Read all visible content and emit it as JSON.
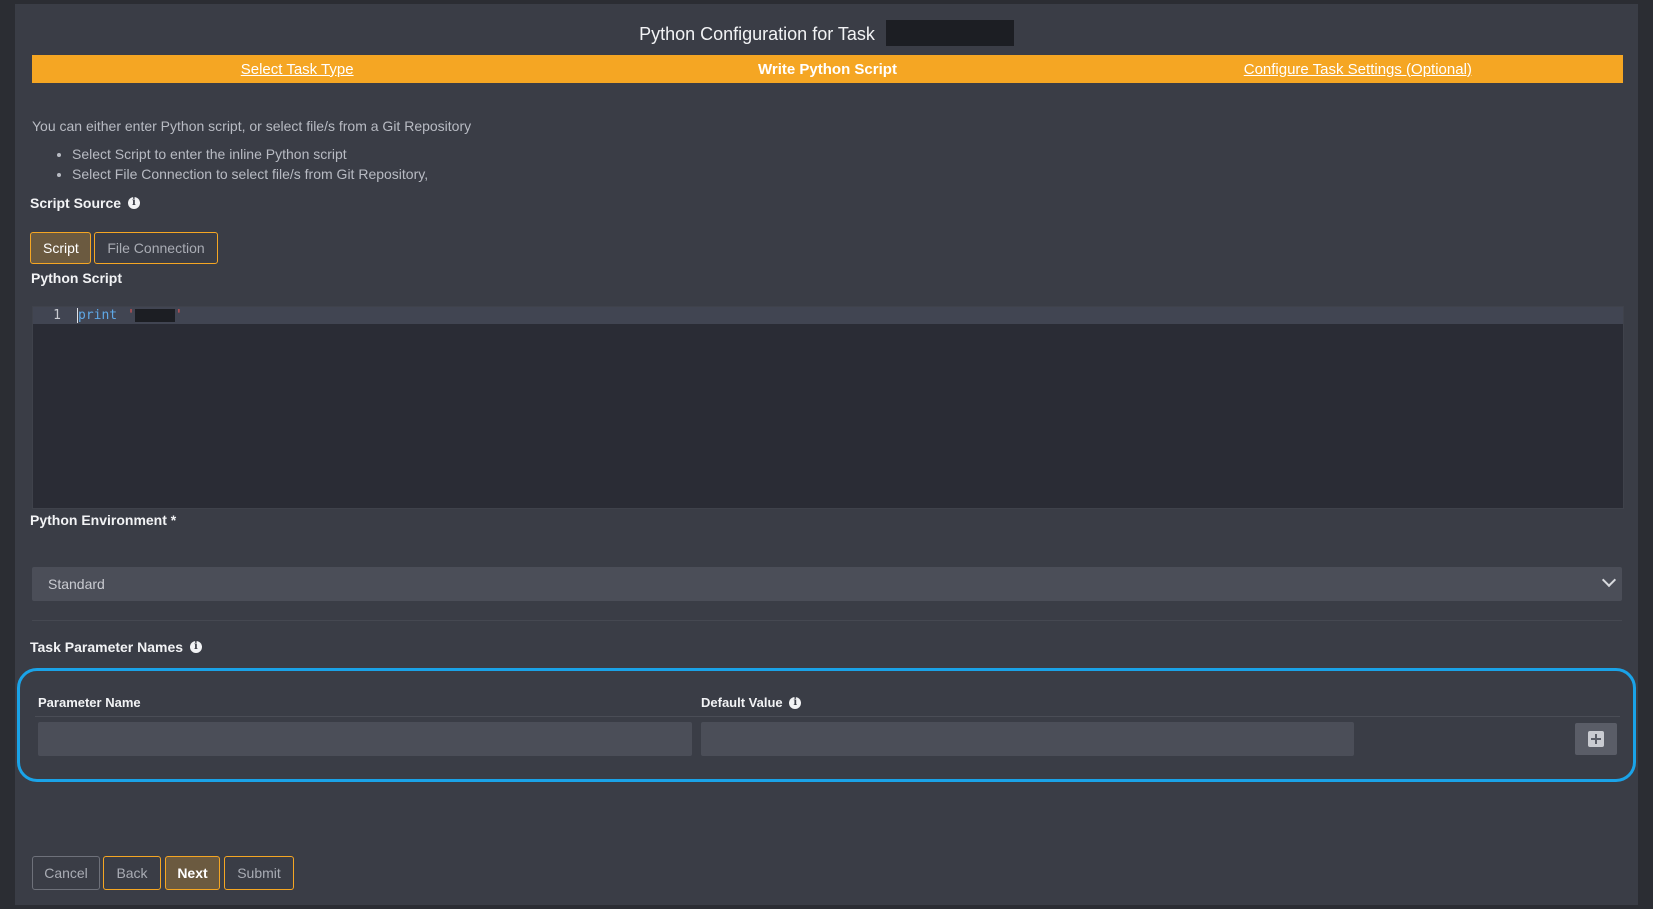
{
  "page": {
    "title": "Python Configuration for Task"
  },
  "wizard": {
    "steps": [
      {
        "label": "Select Task Type",
        "active": false
      },
      {
        "label": "Write Python Script",
        "active": true
      },
      {
        "label": "Configure Task Settings (Optional)",
        "active": false
      }
    ]
  },
  "intro": {
    "text": "You can either enter Python script, or select file/s from a Git Repository",
    "bullets": [
      "Select Script to enter the inline Python script",
      "Select File Connection to select file/s from Git Repository,"
    ]
  },
  "script_source": {
    "label": "Script Source",
    "options": [
      "Script",
      "File Connection"
    ],
    "selected": "Script"
  },
  "python_script": {
    "label": "Python Script",
    "line_number": "1",
    "code_keyword": "print"
  },
  "environment": {
    "label": "Python Environment *",
    "value": "Standard"
  },
  "parameters": {
    "label": "Task Parameter Names",
    "col_name": "Parameter Name",
    "col_default": "Default Value"
  },
  "footer": {
    "cancel": "Cancel",
    "back": "Back",
    "next": "Next",
    "submit": "Submit"
  },
  "colors": {
    "accent": "#f5a623",
    "highlight_border": "#1aa3e8",
    "panel": "#3a3d46",
    "background": "#2b2d33"
  },
  "icons": [
    "info-icon",
    "chevron-down-icon",
    "plus-square-icon"
  ]
}
